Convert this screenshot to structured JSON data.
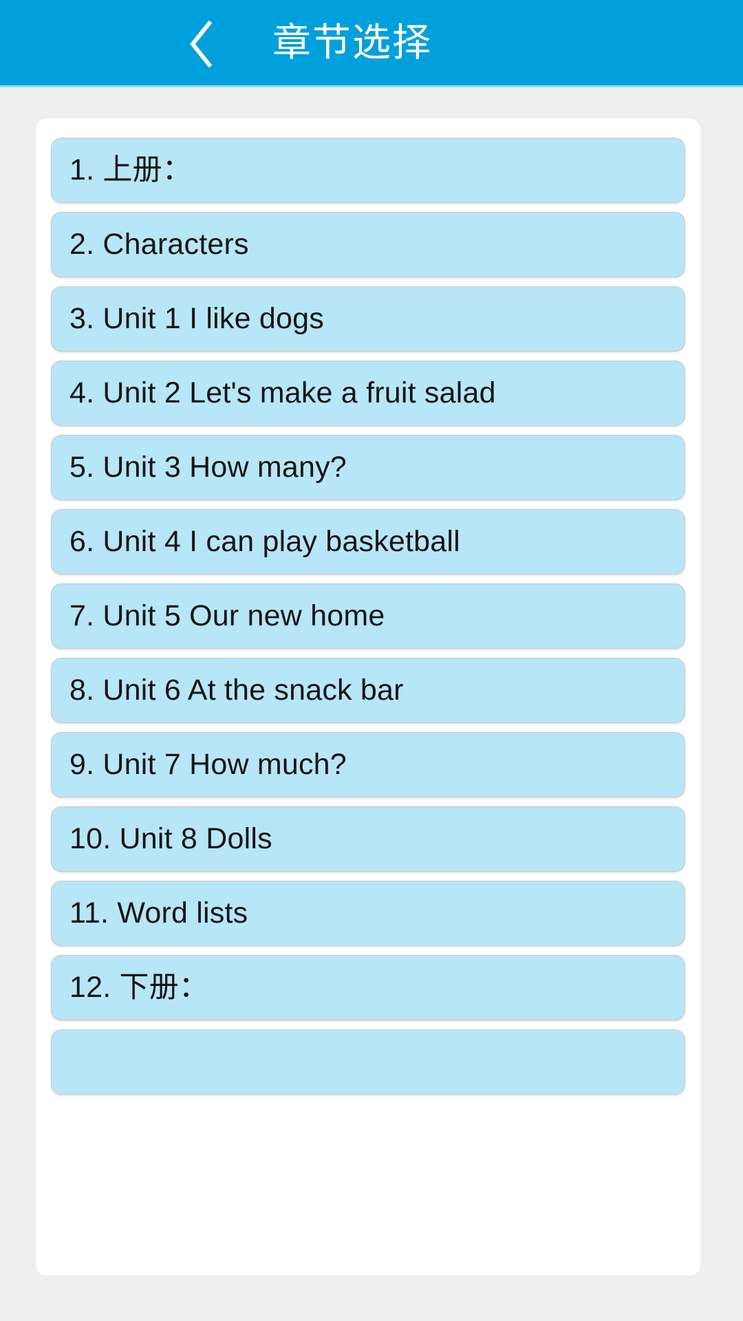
{
  "header": {
    "title": "章节选择",
    "back_icon": "chevron-left-icon",
    "background_color": "#00A0DC",
    "text_color": "#FFFFFF"
  },
  "theme": {
    "page_background": "#EFEFEF",
    "card_background": "#FFFFFF",
    "item_background": "#B7E6F7",
    "item_border": "#C9C9C9",
    "item_text": "#151515"
  },
  "chapter_list": {
    "items": [
      {
        "label": "1. 上册："
      },
      {
        "label": "2. Characters"
      },
      {
        "label": "3. Unit 1 I like dogs"
      },
      {
        "label": "4. Unit 2 Let's make a fruit salad"
      },
      {
        "label": "5. Unit 3 How many?"
      },
      {
        "label": "6. Unit 4 I can play basketball"
      },
      {
        "label": "7. Unit 5 Our new home"
      },
      {
        "label": "8. Unit 6 At the snack bar"
      },
      {
        "label": "9. Unit 7 How much?"
      },
      {
        "label": "10. Unit 8 Dolls"
      },
      {
        "label": "11. Word lists"
      },
      {
        "label": "12. 下册："
      },
      {
        "label": ""
      }
    ]
  }
}
